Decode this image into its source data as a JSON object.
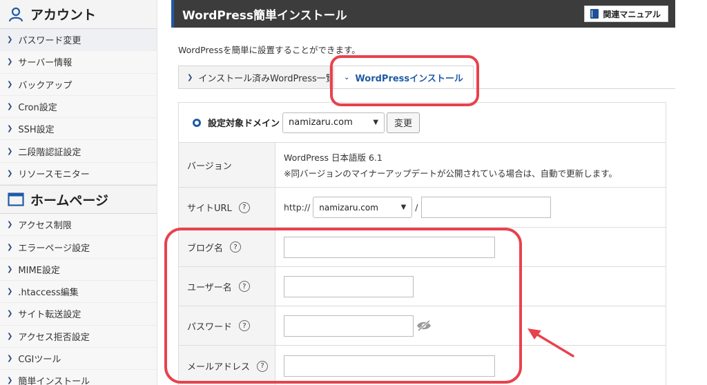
{
  "sidebar": {
    "account": {
      "title": "アカウント",
      "items": [
        "パスワード変更",
        "サーバー情報",
        "バックアップ",
        "Cron設定",
        "SSH設定",
        "二段階認証設定",
        "リソースモニター"
      ]
    },
    "homepage": {
      "title": "ホームページ",
      "items": [
        "アクセス制限",
        "エラーページ設定",
        "MIME設定",
        ".htaccess編集",
        "サイト転送設定",
        "アクセス拒否設定",
        "CGIツール",
        "簡単インストール"
      ]
    }
  },
  "header": {
    "title": "WordPress簡単インストール",
    "manual_label": "関連マニュアル"
  },
  "description": "WordPressを簡単に設置することができます。",
  "tabs": {
    "installed": "インストール済みWordPress一覧",
    "install": "WordPressインストール"
  },
  "domain": {
    "label": "設定対象ドメイン",
    "value": "namizaru.com",
    "change_label": "変更"
  },
  "form": {
    "version": {
      "label": "バージョン",
      "value": "WordPress 日本語版 6.1",
      "note": "※同バージョンのマイナーアップデートが公開されている場合は、自動で更新します。"
    },
    "site_url": {
      "label": "サイトURL",
      "prefix": "http://",
      "domain": "namizaru.com",
      "slash": "/"
    },
    "blog_name": {
      "label": "ブログ名"
    },
    "username": {
      "label": "ユーザー名"
    },
    "password": {
      "label": "パスワード"
    },
    "email": {
      "label": "メールアドレス"
    },
    "help_glyph": "?"
  },
  "colors": {
    "accent": "#1f5aa6",
    "header_bg": "#3c3c3c",
    "highlight": "#e8424c"
  }
}
